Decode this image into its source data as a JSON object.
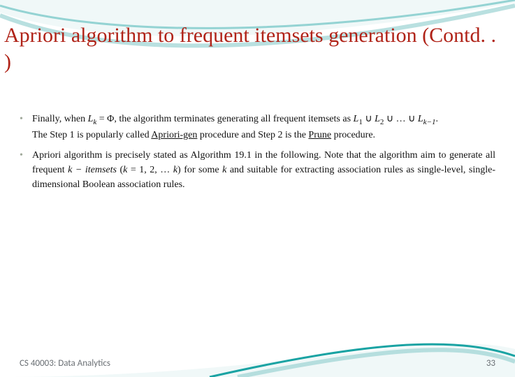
{
  "title": "Apriori algorithm to frequent itemsets generation (Contd. . )",
  "bullets": {
    "b1_pre": "Finally, when ",
    "b1_lk": "L",
    "b1_k": "k",
    "b1_eq": " = Φ, the algorithm terminates generating all frequent itemsets as ",
    "b1_l1": "L",
    "b1_s1": "1",
    "b1_cup1": " ∪ ",
    "b1_l2": "L",
    "b1_s2": "2",
    "b1_cup2": " ∪ … ∪ ",
    "b1_lkm1": "L",
    "b1_km1": "k−1",
    "b1_end": ".",
    "b2_pre": "The Step 1 is popularly called ",
    "b2_ag": "Apriori-gen",
    "b2_mid": " procedure and Step 2 is the ",
    "b2_pr": "Prune",
    "b2_end": " procedure.",
    "b3_pre": "Apriori algorithm is precisely stated as Algorithm 19.1 in the following. Note that the algorithm aim to generate all frequent ",
    "b3_kit": "k − itemsets",
    "b3_par": " (",
    "b3_kv": "k",
    "b3_vals": " = 1, 2, … ",
    "b3_kv2": "k",
    "b3_par2": ") for some ",
    "b3_kv3": "k",
    "b3_tail": " and suitable for extracting association rules as single-level, single-dimensional Boolean association rules."
  },
  "footer": {
    "course": "CS 40003: Data Analytics",
    "page": "33"
  },
  "colors": {
    "title": "#b02318",
    "accentTeal": "#1aa3a3",
    "accentTealFill": "#b8e1e3"
  }
}
